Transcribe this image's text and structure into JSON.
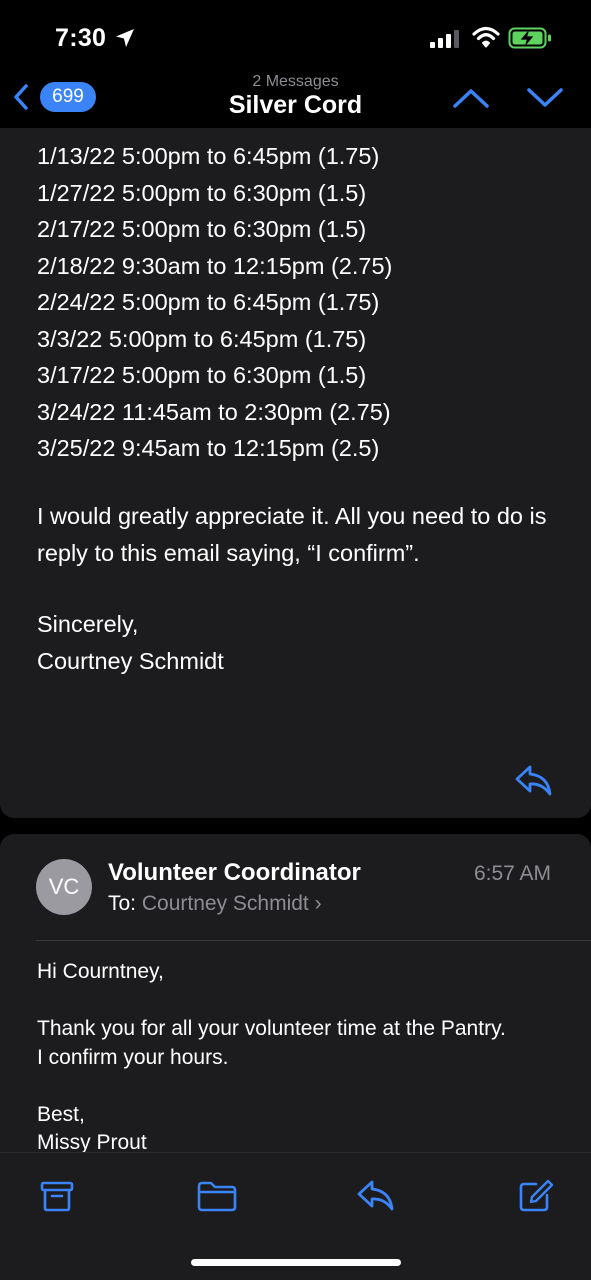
{
  "status": {
    "time": "7:30"
  },
  "nav": {
    "badge_count": "699",
    "subtitle": "2 Messages",
    "title": "Silver Cord"
  },
  "message1": {
    "lines": [
      "1/13/22 5:00pm to 6:45pm (1.75)",
      "1/27/22 5:00pm to 6:30pm (1.5)",
      "2/17/22 5:00pm to 6:30pm (1.5)",
      "2/18/22 9:30am to 12:15pm (2.75)",
      "2/24/22 5:00pm to 6:45pm (1.75)",
      "3/3/22 5:00pm to 6:45pm (1.75)",
      "3/17/22 5:00pm to 6:30pm (1.5)",
      "3/24/22 11:45am to 2:30pm (2.75)",
      "3/25/22 9:45am to 12:15pm (2.5)"
    ],
    "paragraph": "I would greatly appreciate it. All you need to do is reply to this email saying, “I confirm”.",
    "closing": "Sincerely,",
    "signature": "Courtney Schmidt"
  },
  "message2": {
    "avatar_initials": "VC",
    "sender": "Volunteer Coordinator",
    "time": "6:57 AM",
    "to_label": "To:",
    "to_name": "Courtney Schmidt",
    "greeting": "Hi Courntney,",
    "body_line1": "Thank you for all your volunteer time at the Pantry.",
    "body_line2": "I confirm your hours.",
    "closing": "Best,",
    "signature": "Missy Prout"
  },
  "colors": {
    "accent": "#3a84f7",
    "card_bg": "#1c1c1e",
    "secondary_text": "#8d8d93"
  },
  "icons": [
    "location-arrow-icon",
    "signal-icon",
    "wifi-icon",
    "battery-charging-icon",
    "back-chevron-icon",
    "chevron-up-icon",
    "chevron-down-icon",
    "reply-icon",
    "archive-icon",
    "folder-icon",
    "compose-icon"
  ]
}
